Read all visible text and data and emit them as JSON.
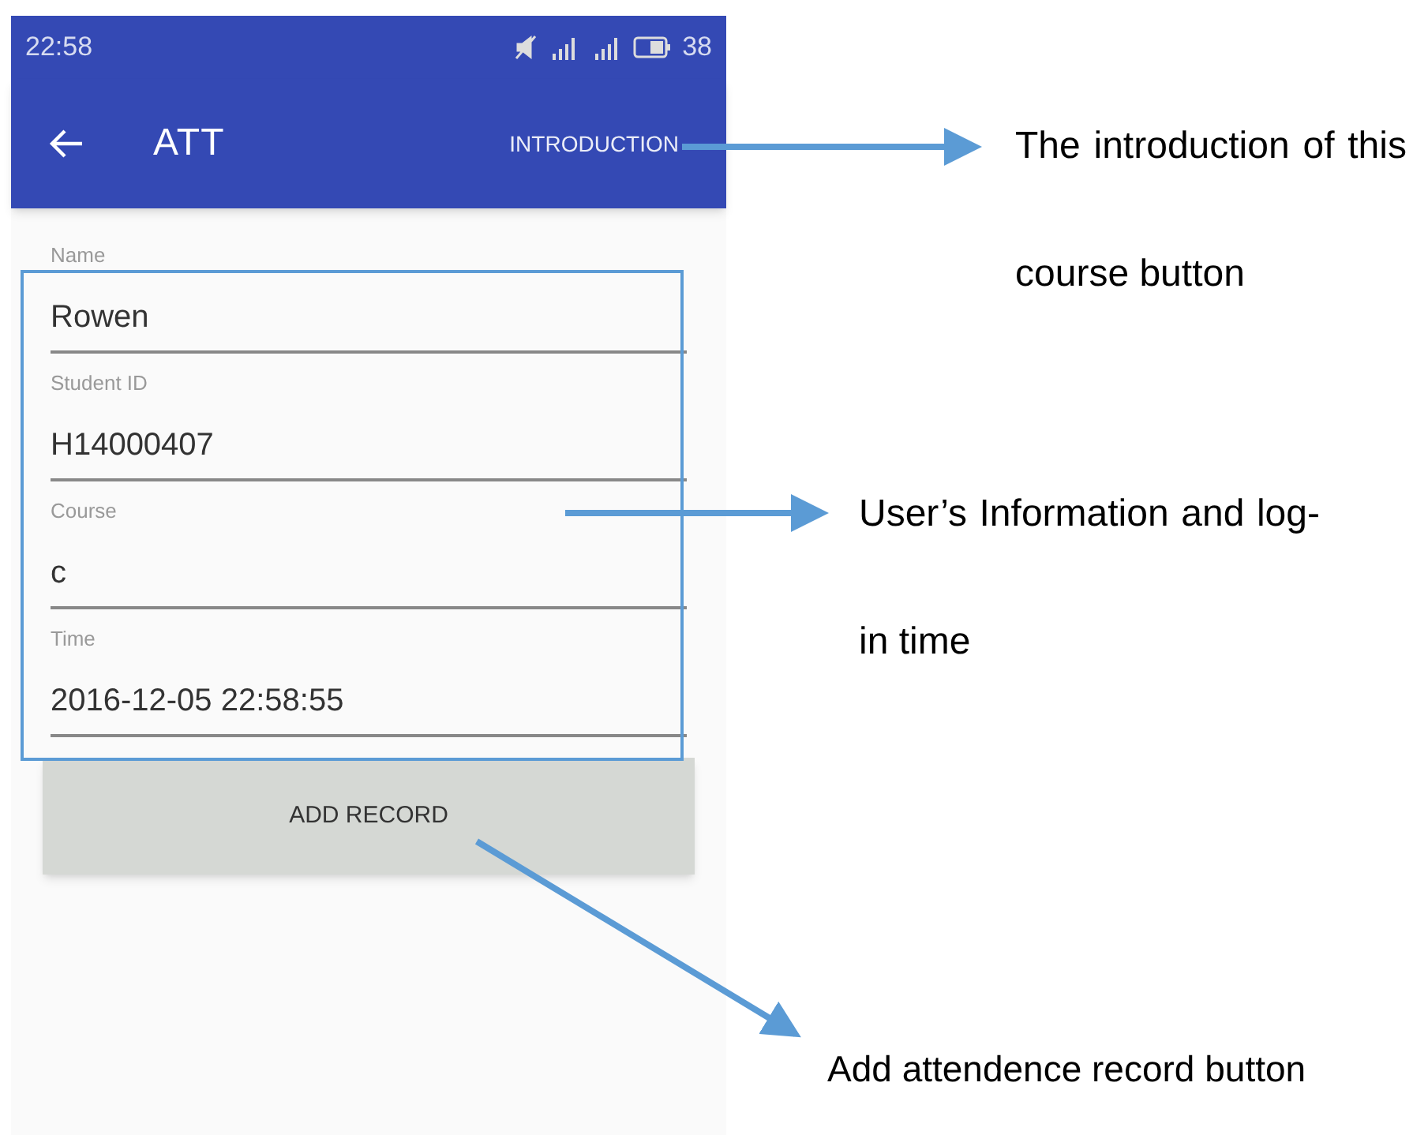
{
  "status_bar": {
    "time": "22:58",
    "battery": "38"
  },
  "app_bar": {
    "title": "ATT",
    "action": "INTRODUCTION"
  },
  "fields": [
    {
      "label": "Name",
      "value": "Rowen"
    },
    {
      "label": "Student ID",
      "value": "H14000407"
    },
    {
      "label": "Course",
      "value": "c"
    },
    {
      "label": "Time",
      "value": "2016-12-05 22:58:55"
    }
  ],
  "button": "ADD RECORD",
  "annotations": [
    {
      "text": "The introduction of this course button"
    },
    {
      "text": "User’s Information and log-in time"
    },
    {
      "text": "Add attendence record button"
    }
  ]
}
